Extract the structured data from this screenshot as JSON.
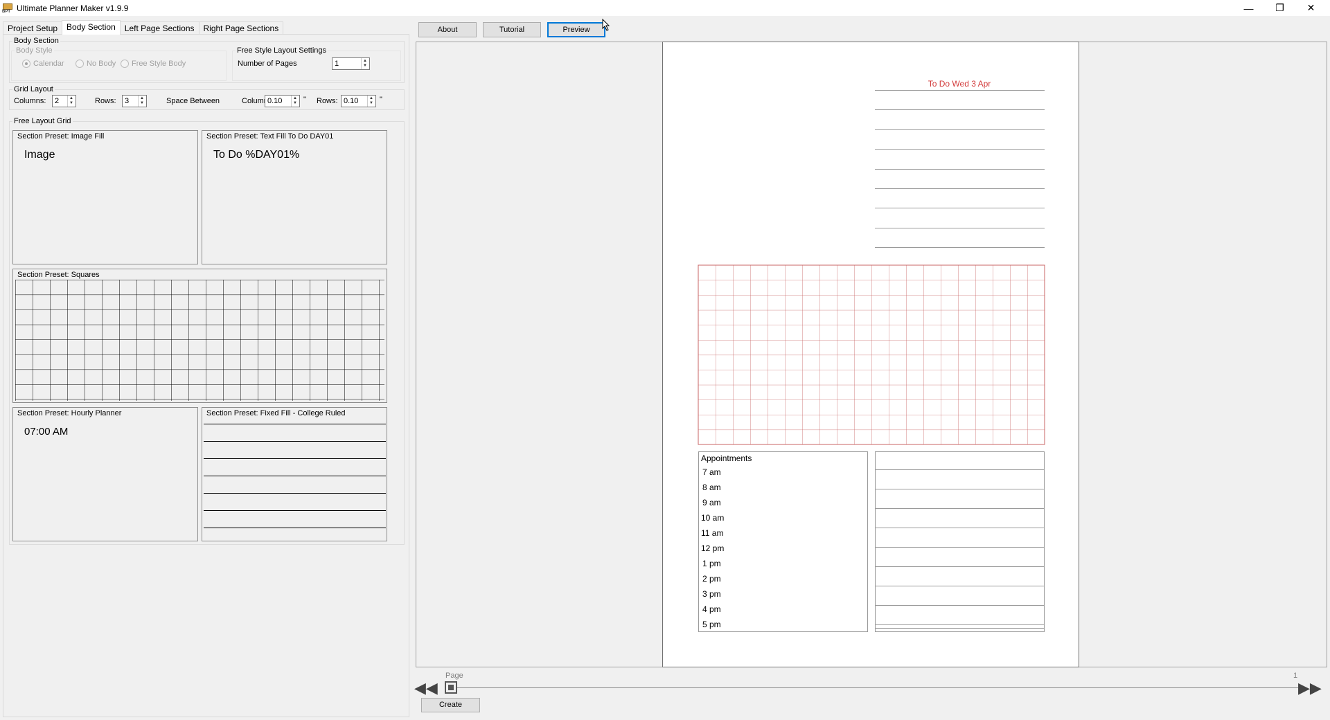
{
  "window": {
    "title": "Ultimate Planner Maker v1.9.9",
    "icon_letters": "BPT"
  },
  "tabs": [
    {
      "label": "Project Setup"
    },
    {
      "label": "Body Section"
    },
    {
      "label": "Left Page Sections"
    },
    {
      "label": "Right Page Sections"
    }
  ],
  "body_section": {
    "group_label": "Body Section",
    "body_style": {
      "label": "Body Style",
      "options": [
        "Calendar",
        "No Body",
        "Free Style Body"
      ],
      "selected": "Calendar"
    },
    "free_style": {
      "label": "Free Style Layout Settings",
      "num_pages_label": "Number of Pages",
      "num_pages_value": "1"
    }
  },
  "grid_layout": {
    "label": "Grid Layout",
    "columns_label": "Columns:",
    "columns_value": "2",
    "rows_label": "Rows:",
    "rows_value": "3",
    "space_between_label": "Space Between",
    "space_columns_label": "Columns:",
    "space_columns_value": "0.10",
    "space_rows_label": "Rows:",
    "space_rows_value": "0.10",
    "unit": "\""
  },
  "free_layout_grid": {
    "label": "Free Layout Grid",
    "presets": [
      {
        "title": "Section Preset: Image Fill",
        "content": "Image"
      },
      {
        "title": "Section Preset: Text Fill To Do DAY01",
        "content": "To Do %DAY01%"
      },
      {
        "title": "Section Preset: Squares",
        "content": ""
      },
      {
        "title": "Section Preset: Hourly Planner",
        "content": "07:00 AM"
      },
      {
        "title": "Section Preset: Fixed Fill - College Ruled",
        "content": ""
      }
    ]
  },
  "toolbar": {
    "about": "About",
    "tutorial": "Tutorial",
    "preview": "Preview"
  },
  "preview": {
    "todo_title": "To Do Wed 3 Apr",
    "appointments_label": "Appointments",
    "hours": [
      "7 am",
      "8 am",
      "9 am",
      "10 am",
      "11 am",
      "12 pm",
      "1 pm",
      "2 pm",
      "3 pm",
      "4 pm",
      "5 pm"
    ],
    "accent_color": "#d23a3a",
    "grid_color": "#c86464"
  },
  "pager": {
    "page_label": "Page",
    "page_number": "1",
    "create_label": "Create"
  }
}
